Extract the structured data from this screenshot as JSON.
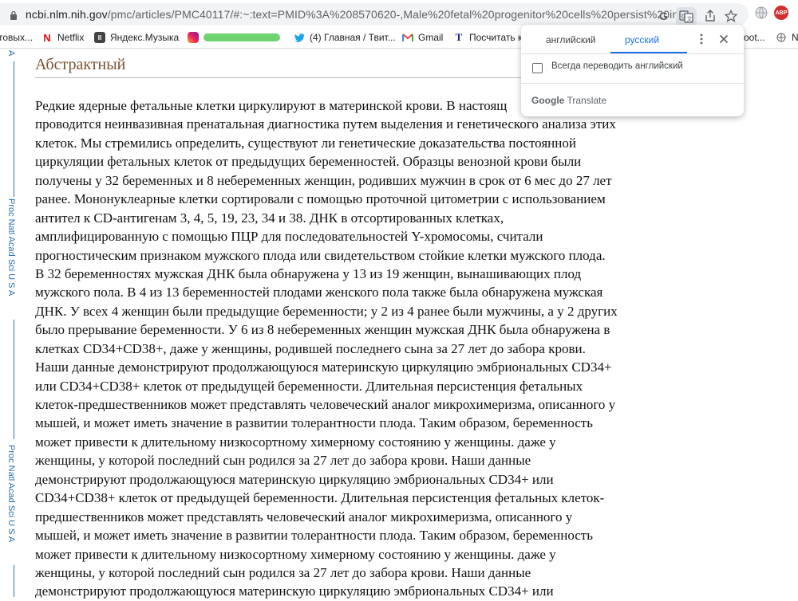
{
  "address_bar": {
    "url_host": "ncbi.nlm.nih.gov",
    "url_path": "/pmc/articles/PMC40117/#:~:text=PMID%3A%208570620-,Male%20fetal%20progenitor%20cells%20persist%20in..."
  },
  "bookmarks": [
    {
      "label": "товых...",
      "icon": "folder-icon"
    },
    {
      "label": "Netflix",
      "icon": "netflix-icon"
    },
    {
      "label": "Яндекс.Музыка",
      "icon": "yandex-music-icon"
    },
    {
      "label": "",
      "icon": "instagram-icon"
    },
    {
      "label": "(4) Главная / Твит...",
      "icon": "twitter-icon"
    },
    {
      "label": "Gmail",
      "icon": "gmail-icon"
    },
    {
      "label": "Посчитать к",
      "icon": "t-icon"
    },
    {
      "label": "oot...",
      "icon": "bookmark-icon"
    },
    {
      "label": "Na",
      "icon": "globe-icon"
    }
  ],
  "sidebar": {
    "top_label": "A",
    "labels": [
      "Proc Natl Acad Sci U S A",
      "Proc Natl Acad Sci U S A"
    ]
  },
  "article": {
    "heading": "Абстрактный",
    "lines": [
      "Редкие ядерные фетальные клетки циркулируют в материнской крови. В настоящ",
      "проводится неинвазивная пренатальная диагностика путем выделения и генетического анализа этих",
      "клеток. Мы стремились определить, существуют ли генетические доказательства постоянной",
      "циркуляции фетальных клеток от предыдущих беременностей. Образцы венозной крови были",
      "получены у 32 беременных и 8 небеременных женщин, родивших мужчин в срок от 6 мес до 27 лет",
      "ранее. Мононуклеарные клетки сортировали с помощью проточной цитометрии с использованием",
      "антител к CD-антигенам 3, 4, 5, 19, 23, 34 и 38. ДНК в отсортированных клетках,",
      "амплифицированную с помощью ПЦР для последовательностей Y-хромосомы, считали",
      "прогностическим признаком мужского плода или свидетельством стойкие клетки мужского плода.",
      "В 32 беременностях мужская ДНК была обнаружена у 13 из 19 женщин, вынашивающих плод",
      "мужского пола. В 4 из 13 беременностей плодами женского пола также была обнаружена мужская",
      "ДНК. У всех 4 женщин были предыдущие беременности; у 2 из 4 ранее были мужчины, а у 2 других",
      "было прерывание беременности. У 6 из 8 небеременных женщин мужская ДНК была обнаружена в",
      "клетках CD34+CD38+, даже у женщины, родившей последнего сына за 27 лет до забора крови.",
      "Наши данные демонстрируют продолжающуюся материнскую циркуляцию эмбриональных CD34+",
      "или CD34+CD38+ клеток от предыдущей беременности. Длительная персистенция фетальных",
      "клеток-предшественников может представлять человеческий аналог микрохимеризма, описанного у",
      "мышей, и может иметь значение в развитии толерантности плода. Таким образом, беременность",
      "может привести к длительному низкосортному химерному состоянию у женщины. даже у",
      "женщины, у которой последний сын родился за 27 лет до забора крови. Наши данные",
      "демонстрируют продолжающуюся материнскую циркуляцию эмбриональных CD34+ или",
      "CD34+CD38+ клеток от предыдущей беременности. Длительная персистенция фетальных клеток-",
      "предшественников может представлять человеческий аналог микрохимеризма, описанного у",
      "мышей, и может иметь значение в развитии толерантности плода. Таким образом, беременность",
      "может привести к длительному низкосортному химерному состоянию у женщины. даже у",
      "женщины, у которой последний сын родился за 27 лет до забора крови. Наши данные",
      "демонстрируют продолжающуюся материнскую циркуляцию эмбриональных CD34+ или"
    ]
  },
  "translate_popup": {
    "source_lang": "английский",
    "target_lang": "русский",
    "always_translate_label": "Всегда переводить английский",
    "always_translate_checked": false,
    "brand_google": "Google",
    "brand_translate": "Translate"
  },
  "colors": {
    "accent_blue": "#1a73e8",
    "heading_brown": "#7a5230",
    "sidebar_blue": "#2a6fb3"
  }
}
